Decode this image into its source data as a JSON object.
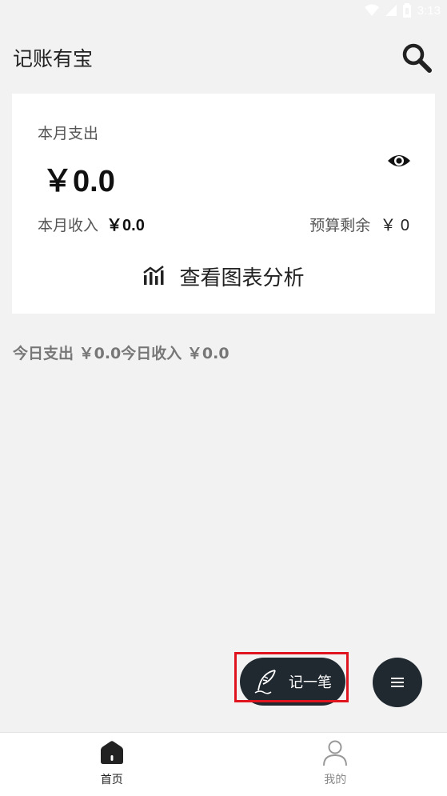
{
  "status_bar": {
    "time": "3:13"
  },
  "header": {
    "title": "记账有宝",
    "search_icon": "search-icon"
  },
  "summary_card": {
    "monthly_expense_label": "本月支出",
    "monthly_expense_amount": "￥0.0",
    "monthly_income_label": "本月收入",
    "monthly_income_amount": "￥0.0",
    "budget_remaining_label": "预算剩余",
    "budget_remaining_amount": "￥ 0",
    "chart_link_label": "查看图表分析",
    "visibility_icon": "eye-icon",
    "chart_icon": "chart-analytics-icon"
  },
  "today": {
    "summary": "今日支出 ￥0.0今日收入 ￥0.0"
  },
  "fab": {
    "record_label": "记一笔",
    "record_icon": "quill-pen-icon",
    "menu_icon": "menu-icon"
  },
  "bottom_nav": {
    "items": [
      {
        "label": "首页",
        "icon": "home-icon",
        "active": true
      },
      {
        "label": "我的",
        "icon": "user-icon",
        "active": false
      }
    ]
  },
  "colors": {
    "background": "#f2f2f2",
    "card": "#ffffff",
    "fab": "#202830",
    "highlight": "#e0141e",
    "text_primary": "#222222",
    "text_secondary": "#555555"
  }
}
